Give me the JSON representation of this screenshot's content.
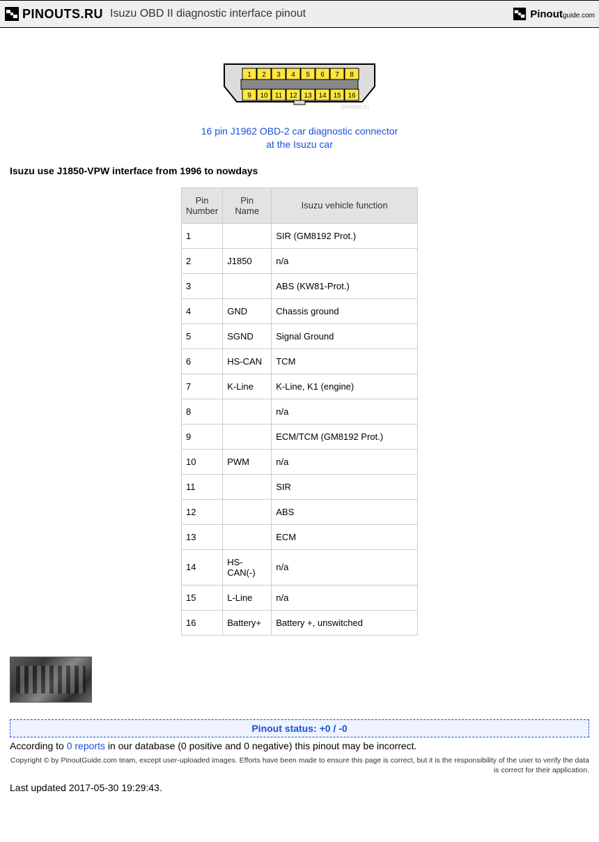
{
  "header": {
    "logo_left": "PINOUTS.RU",
    "title": "Isuzu OBD II diagnostic interface pinout",
    "logo_right_main": "Pinout",
    "logo_right_sub": "guide.com"
  },
  "connector": {
    "pins": [
      "1",
      "2",
      "3",
      "4",
      "5",
      "6",
      "7",
      "8",
      "9",
      "10",
      "11",
      "12",
      "13",
      "14",
      "15",
      "16"
    ],
    "watermark": "pinouts.ru",
    "caption_l1": "16 pin J1962 OBD-2 car diagnostic connector",
    "caption_l2": "at the Isuzu car"
  },
  "intro": "Isuzu use J1850-VPW interface from 1996 to nowdays",
  "table": {
    "headers": [
      "Pin Number",
      "Pin Name",
      "Isuzu vehicle function"
    ],
    "rows": [
      {
        "num": "1",
        "name": "",
        "func": "SIR (GM8192 Prot.)"
      },
      {
        "num": "2",
        "name": "J1850",
        "func": "n/a"
      },
      {
        "num": "3",
        "name": "",
        "func": " ABS (KW81-Prot.)"
      },
      {
        "num": "4",
        "name": "GND",
        "func": " Chassis ground"
      },
      {
        "num": "5",
        "name": "SGND",
        "func": " Signal Ground"
      },
      {
        "num": "6",
        "name": "HS-CAN",
        "func": "TCM"
      },
      {
        "num": "7",
        "name": "K-Line",
        "func": "K-Line, K1 (engine)"
      },
      {
        "num": "8",
        "name": "",
        "func": "n/a"
      },
      {
        "num": "9",
        "name": "",
        "func": "ECM/TCM (GM8192 Prot.)"
      },
      {
        "num": "10",
        "name": " PWM",
        "func": "n/a"
      },
      {
        "num": "11",
        "name": "",
        "func": "SIR"
      },
      {
        "num": "12",
        "name": "",
        "func": "ABS"
      },
      {
        "num": "13",
        "name": "",
        "func": "ECM"
      },
      {
        "num": "14",
        "name": " HS-CAN(-)",
        "func": "n/a"
      },
      {
        "num": "15",
        "name": "L-Line",
        "func": "n/a"
      },
      {
        "num": "16",
        "name": " Battery+",
        "func": "Battery +, unswitched"
      }
    ]
  },
  "status": {
    "bar": "Pinout status: +0 / -0",
    "note_pre": "According to ",
    "note_link": "0 reports",
    "note_post": " in our database (0 positive and 0 negative) this pinout may be incorrect."
  },
  "copyright": "Copyright © by PinoutGuide.com team, except user-uploaded images. Efforts have been made to ensure this page is correct, but it is the responsibility of the user to verify the data is correct for their application.",
  "updated": "Last updated 2017-05-30 19:29:43."
}
